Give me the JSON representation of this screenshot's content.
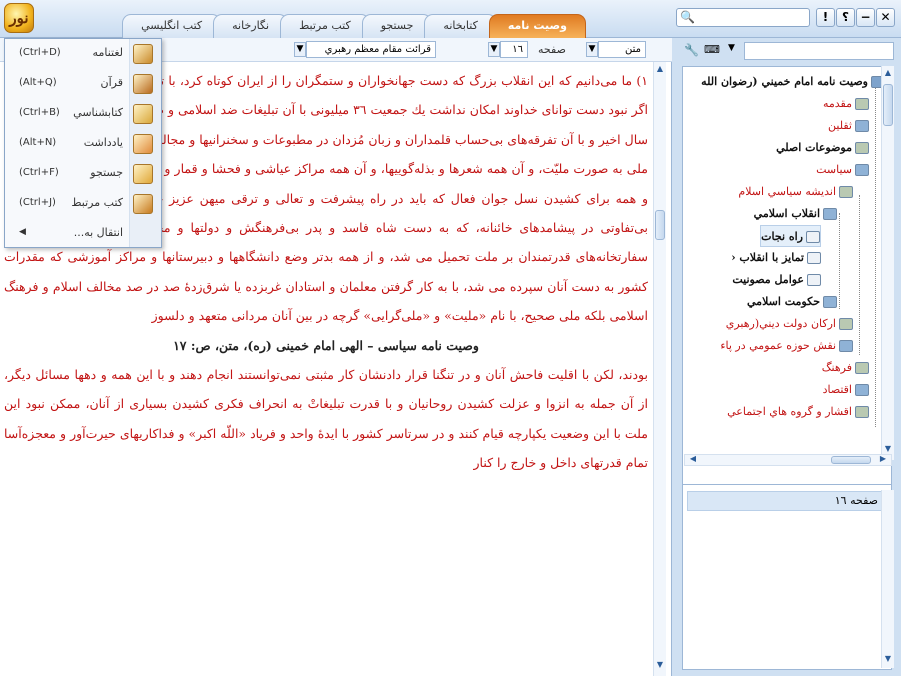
{
  "app": {
    "logo_text": "نور"
  },
  "tabs": [
    {
      "label": "وصيت نامه",
      "active": true
    },
    {
      "label": "کتابخانه",
      "active": false
    },
    {
      "label": "جستجو",
      "active": false
    },
    {
      "label": "کتب مرتبط",
      "active": false
    },
    {
      "label": "نگارخانه",
      "active": false
    },
    {
      "label": "کتب انگليسي",
      "active": false
    }
  ],
  "window_buttons": [
    "✕",
    "−",
    "؟",
    "!"
  ],
  "toolbar": {
    "view_mode": "متن",
    "page_label": "صفحه",
    "page_number": "١٦",
    "reading_label": "قرائت مقام معظم رهبري"
  },
  "menu": {
    "items": [
      {
        "label": "لغتنامه",
        "shortcut": "(Ctrl+D)",
        "icon": "dictionary-icon",
        "color": "#c98a2a"
      },
      {
        "label": "قرآن",
        "shortcut": "(Alt+Q)",
        "icon": "quran-icon",
        "color": "#b86a1e"
      },
      {
        "label": "کتابشناسي",
        "shortcut": "(Ctrl+B)",
        "icon": "bibliography-icon",
        "color": "#d9a83a"
      },
      {
        "label": "يادداشت",
        "shortcut": "(Alt+N)",
        "icon": "note-icon",
        "color": "#e08a3a"
      },
      {
        "label": "جستجو",
        "shortcut": "(Ctrl+F)",
        "icon": "search-icon",
        "color": "#e0a838"
      },
      {
        "label": "کتب مرتبط",
        "shortcut": "(Ctrl+J)",
        "icon": "related-books-icon",
        "color": "#c77a1e"
      },
      {
        "label": "انتقال به...",
        "shortcut": "",
        "icon": "",
        "color": ""
      }
    ]
  },
  "text": {
    "paragraphs": [
      {
        "style": "red",
        "text": "١) ما مى‌دانيم كه اين انقلاب بزرگ كه دست جهانخواران و ستمگران را از ايران كوتاه كرد، با تأييدات غيبى الهى پيروز گرديد. اگر نبود دست تواناى خداوند امكان نداشت يك جمعيت ٣٦ ميليونى با آن تبليغات ضد اسلامى و ضد روحانى خصوص در اين صد سال اخير و با آن تفرقه‌هاى بى‌حساب قلمداران و زبان مُزدان در مطبوعات و سخنرانيها و مجالس و محافل ضد اسلامى و ضد ملى به صورت مليّت، و آن همه شعرها و بذله‌گوييها، و آن همه مراكز عياشى و فحشا و قمار و مسكرات و مواد مخدر كه همه و همه براى كشيدن نسل جوان فعال كه بايد در راه پيشرفت و تعالى و ترقى ميهن عزيز خود فعاليت نمايند، به فساد و بى‌تفاوتى در پيشامدهاى خائنانه، كه به دست شاه فاسد و پدر بى‌فرهنگش و دولتها و مجالس فرمايشى كه از طرف سفارتخانه‌هاى قدرتمندان بر ملت تحميل مى شد، و از همه بدتر وضع دانشگاهها و دبيرستانها و مراكز آموزشى كه مقدرات كشور به دست آنان سپرده مى شد، با به كار گرفتن معلمان و استادان غربزده يا شرق‌زدهٔ صد در صد مخالف اسلام و فرهنگ اسلامى بلكه ملى صحيح، با نام «مليت» و «ملى‌گرايى» گرچه در بين آنان مردانى متعهد و دلسوز"
      },
      {
        "style": "ref",
        "text": "وصيت نامه سياسى – الهى امام خمينى (ره)، متن، ص: ١٧"
      },
      {
        "style": "red",
        "text": "بودند، لكن با اقليت فاحش آنان و در تنگنا قرار دادنشان كار مثبتى نمى‌توانستند انجام دهند و با اين همه و دهها مسائل ديگر، از آن جمله به انزوا و عزلت كشيدن روحانيان و با قدرت تبليغاتْ به انحراف فكرى كشيدن بسيارى از آنان، ممكن نبود اين ملت با اين وضعيت يكپارچه قيام كنند و در سرتاسر كشور با ايدهٔ واحد و فرياد «اللّه اكبر» و فداكاريهاى حيرت‌آور و معجزه‌آسا تمام قدرتهاى داخل و خارج را كنار"
      }
    ]
  },
  "side": {
    "tree": [
      {
        "label": "وصيت نامه امام خميني (رضوان الله",
        "style": "dark",
        "level": 0
      },
      {
        "label": "مقدمه",
        "style": "red",
        "level": 1
      },
      {
        "label": "ثقلين",
        "style": "red",
        "level": 1
      },
      {
        "label": "موضوعات اصلي",
        "style": "dark",
        "level": 1
      },
      {
        "label": "سياست",
        "style": "red",
        "level": 1
      },
      {
        "label": "انديشه سياسي اسلام",
        "style": "red",
        "level": 2
      },
      {
        "label": "انقلاب اسلامي",
        "style": "dark",
        "level": 3
      },
      {
        "label": "راه نجات",
        "style": "dark",
        "level": 4,
        "selected": true
      },
      {
        "label": "تمايز با انقلاب ‹",
        "style": "dark",
        "level": 4
      },
      {
        "label": "عوامل مصونيت",
        "style": "dark",
        "level": 4
      },
      {
        "label": "حكومت اسلامي",
        "style": "dark",
        "level": 3
      },
      {
        "label": "اركان دولت ديني(رهبري",
        "style": "red",
        "level": 2
      },
      {
        "label": "نقش حوزه عمومي در پاء",
        "style": "red",
        "level": 2
      },
      {
        "label": "فرهنگ",
        "style": "red",
        "level": 1
      },
      {
        "label": "اقتصاد",
        "style": "red",
        "level": 1
      },
      {
        "label": "اقشار و گروه هاي اجتماعي",
        "style": "red",
        "level": 1
      }
    ],
    "results": [
      {
        "label": "صفحه ١٦"
      }
    ]
  }
}
